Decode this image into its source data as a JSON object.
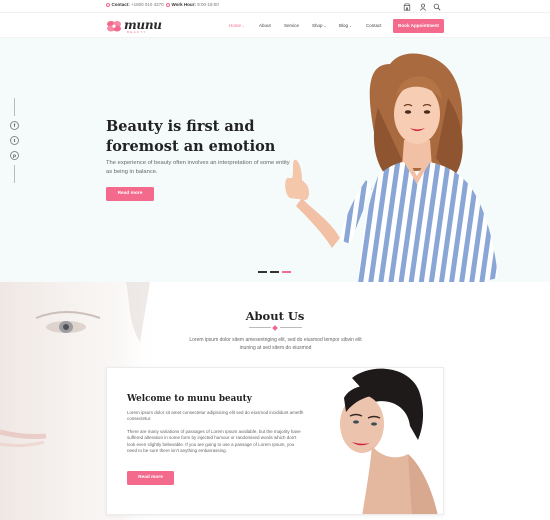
{
  "topbar": {
    "contact_label": "Contact:",
    "contact_value": "+1800 010 4270",
    "work_label": "Work Hour:",
    "work_value": "9:00-18:00",
    "icons": [
      "store-icon",
      "user-icon",
      "search-icon"
    ]
  },
  "header": {
    "logo_word": "munu",
    "logo_sub": "BEAUTY",
    "nav": [
      {
        "label": "Home",
        "dropdown": true,
        "active": true
      },
      {
        "label": "About",
        "dropdown": false,
        "active": false
      },
      {
        "label": "Service",
        "dropdown": false,
        "active": false
      },
      {
        "label": "Shop",
        "dropdown": true,
        "active": false
      },
      {
        "label": "Blog",
        "dropdown": true,
        "active": false
      },
      {
        "label": "Contact",
        "dropdown": false,
        "active": false
      }
    ],
    "cta": "Book Appointment"
  },
  "hero": {
    "title": "Beauty is first and foremost an emotion",
    "text": "The experience of beauty often involves an interpretation of some entity as being in balance.",
    "button": "Read more",
    "social": [
      "f",
      "t",
      "p"
    ],
    "slide_count": 3,
    "active_slide": 3
  },
  "about": {
    "title": "About Us",
    "lead": "Lorem ipsum dolor sitem amesentnging elit, sed do eiusmod tempor sibvin elit inuning at sed sitem do eiusmod",
    "card_title": "Welcome to munu beauty",
    "card_text1": "Lorem ipsum dolor sit amet consectetur adipisicing elit sed do eiusmod incididunt ametfh consectetur.",
    "card_text2": "There are many variations of passages of Lorem Ipsum available, but the majority have suffered alteration in some form by injected humour or randomised words which don't look even slightly believable. If you are going to use a passage of Lorem Ipsum, you need to be sure there isn't anything embarrassing.",
    "card_button": "Read more"
  },
  "colors": {
    "accent": "#f36a8d",
    "hero_bg": "#f5fbfb",
    "heading": "#222222"
  }
}
